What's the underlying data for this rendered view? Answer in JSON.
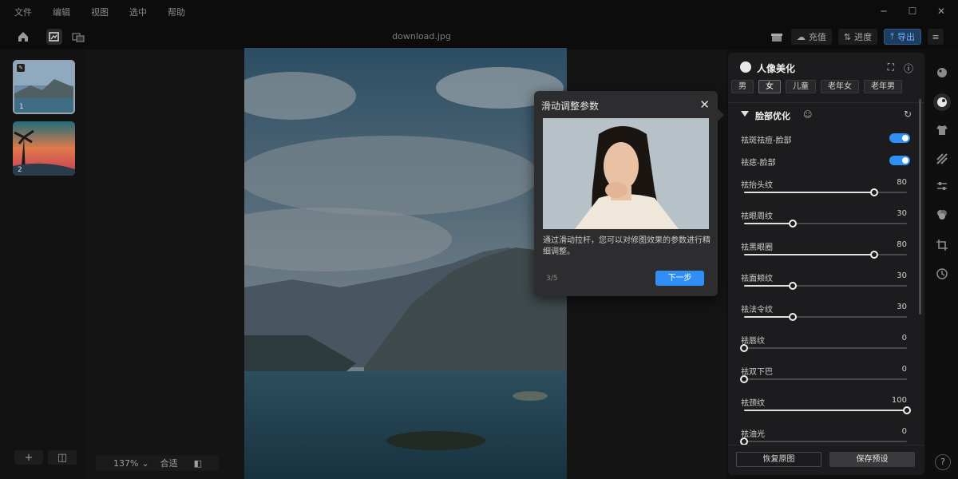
{
  "menu": [
    "文件",
    "编辑",
    "视图",
    "选中",
    "帮助"
  ],
  "toolbar": {
    "filename": "download.jpg",
    "recharge_label": "充值",
    "progress_label": "进度",
    "export_label": "导出"
  },
  "thumbnails": [
    {
      "number": "1",
      "selected": true
    },
    {
      "number": "2",
      "selected": false
    }
  ],
  "canvas": {
    "zoom": "137%",
    "fit_label": "合适"
  },
  "guide": {
    "title": "滑动调整参数",
    "text": "通过滑动拉杆，您可以对修图效果的参数进行精细调整。",
    "step": "3/5",
    "next_label": "下一步"
  },
  "panel": {
    "title": "人像美化",
    "tags": [
      "男",
      "女",
      "儿童",
      "老年女",
      "老年男"
    ],
    "active_tag_index": 1,
    "section_title": "脸部优化",
    "toggles": [
      {
        "label": "祛斑祛痘-脸部",
        "on": true
      },
      {
        "label": "祛痣-脸部",
        "on": true
      }
    ],
    "sliders": [
      {
        "label": "祛抬头纹",
        "value": "80",
        "percent": 80
      },
      {
        "label": "祛眼周纹",
        "value": "30",
        "percent": 30
      },
      {
        "label": "祛黑眼圈",
        "value": "80",
        "percent": 80
      },
      {
        "label": "祛面颊纹",
        "value": "30",
        "percent": 30
      },
      {
        "label": "祛法令纹",
        "value": "30",
        "percent": 30
      },
      {
        "label": "祛唇纹",
        "value": "0",
        "percent": 0
      },
      {
        "label": "祛双下巴",
        "value": "0",
        "percent": 0
      },
      {
        "label": "祛颈纹",
        "value": "100",
        "percent": 100
      },
      {
        "label": "祛油光",
        "value": "0",
        "percent": 0
      }
    ],
    "reset_label": "恢复原图",
    "save_label": "保存预设"
  },
  "colors": {
    "accent": "#2f8ff5",
    "panel_bg": "#1c1c1e",
    "app_bg": "#101011"
  },
  "icons": [
    "home-icon",
    "edit-image-icon",
    "batch-icon",
    "gift-icon",
    "cloud-icon",
    "progress-icon",
    "export-icon",
    "portrait-icon",
    "clothes-icon",
    "texture-icon",
    "adjust-icon",
    "color-icon",
    "crop-icon",
    "history-icon",
    "help-icon"
  ]
}
